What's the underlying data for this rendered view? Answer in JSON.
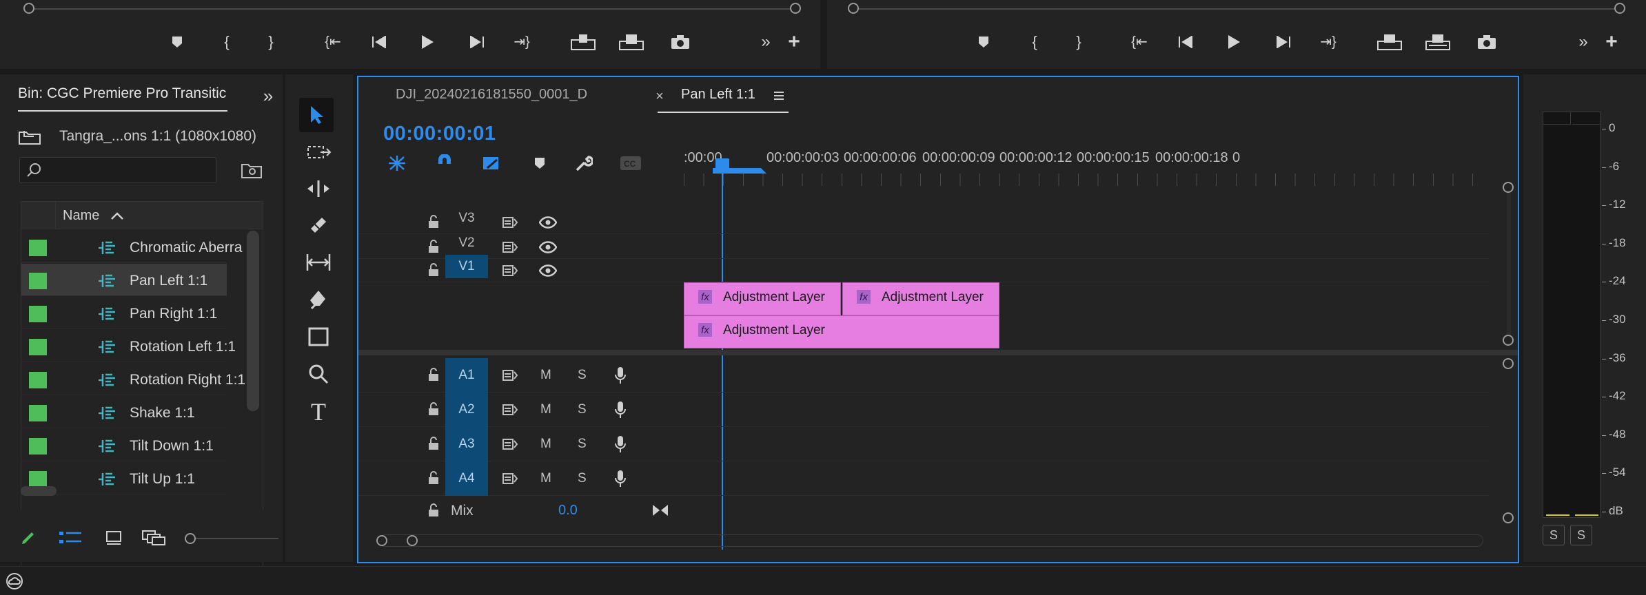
{
  "source_monitor": {
    "scrub": ""
  },
  "program_monitor": {
    "scrub": ""
  },
  "bin": {
    "tab_label": "Bin: CGC Premiere Pro Transitic",
    "path_label": "Tangra_...ons 1:1 (1080x1080)",
    "search_placeholder": "",
    "column_name": "Name",
    "items": [
      {
        "label": "Chromatic Aberra",
        "color": "#4fbe5a"
      },
      {
        "label": "Pan Left 1:1",
        "color": "#4fbe5a",
        "selected": true
      },
      {
        "label": "Pan Right 1:1",
        "color": "#4fbe5a"
      },
      {
        "label": "Rotation Left 1:1",
        "color": "#4fbe5a"
      },
      {
        "label": "Rotation Right 1:1",
        "color": "#4fbe5a"
      },
      {
        "label": "Shake 1:1",
        "color": "#4fbe5a"
      },
      {
        "label": "Tilt Down 1:1",
        "color": "#4fbe5a"
      },
      {
        "label": "Tilt Up 1:1",
        "color": "#4fbe5a"
      }
    ]
  },
  "timeline": {
    "tabs": [
      {
        "label": "DJI_20240216181550_0001_D",
        "active": false
      },
      {
        "label": "Pan Left 1:1",
        "active": true
      }
    ],
    "timecode": "00:00:00:01",
    "ruler": [
      ":00:00",
      "00:00:00:03",
      "00:00:00:06",
      "00:00:00:09",
      "00:00:00:12",
      "00:00:00:15",
      "00:00:00:18",
      "0"
    ],
    "video_tracks": [
      {
        "name": "V3",
        "targeted": false
      },
      {
        "name": "V2",
        "targeted": false
      },
      {
        "name": "V1",
        "targeted": true
      }
    ],
    "audio_tracks": [
      {
        "name": "A1",
        "m": "M",
        "s": "S"
      },
      {
        "name": "A2",
        "m": "M",
        "s": "S"
      },
      {
        "name": "A3",
        "m": "M",
        "s": "S"
      },
      {
        "name": "A4",
        "m": "M",
        "s": "S"
      }
    ],
    "mix": {
      "label": "Mix",
      "value": "0.0"
    },
    "clips": [
      {
        "track": "V2",
        "label": "Adjustment Layer",
        "fx": "fx"
      },
      {
        "track": "V2",
        "label": "Adjustment Layer",
        "fx": "fx"
      },
      {
        "track": "V1",
        "label": "Adjustment Layer",
        "fx": "fx"
      }
    ],
    "clip_color": "#e57ee0"
  },
  "meter": {
    "ticks": [
      "0",
      "-6",
      "-12",
      "-18",
      "-24",
      "-30",
      "-36",
      "-42",
      "-48",
      "-54",
      "dB"
    ],
    "solo_labels": [
      "S",
      "S"
    ]
  },
  "accent": "#2d8ceb"
}
